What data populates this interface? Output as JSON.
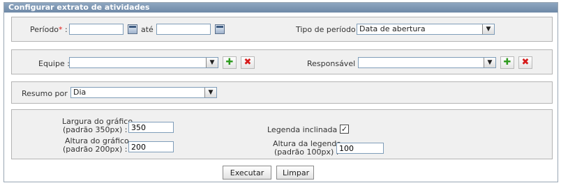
{
  "panel": {
    "title": "Configurar extrato de atividades"
  },
  "periodo": {
    "label": "Período",
    "required_mark": "*",
    "separator": "até",
    "start_value": "",
    "end_value": ""
  },
  "tipo_periodo": {
    "label": "Tipo de período :",
    "selected": "Data de abertura"
  },
  "equipe": {
    "label": "Equipe :",
    "selected": ""
  },
  "responsavel": {
    "label": "Responsável :",
    "selected": ""
  },
  "resumo": {
    "label": "Resumo por :",
    "selected": "Dia"
  },
  "grafico": {
    "largura_label_1": "Largura do gráfico",
    "largura_label_2": "(padrão 350px) :",
    "largura_value": "350",
    "altura_label_1": "Altura do gráfico",
    "altura_label_2": "(padrão 200px) :",
    "altura_value": "200",
    "legenda_inclinada_label": "Legenda inclinada :",
    "legenda_inclinada_checked": true,
    "altura_legenda_label_1": "Altura da legenda",
    "altura_legenda_label_2": "(padrão 100px) :",
    "altura_legenda_value": "100"
  },
  "actions": {
    "execute": "Executar",
    "clear": "Limpar"
  },
  "icons": {
    "check": "✓",
    "dropdown": "▼",
    "add": "✚",
    "remove": "✖"
  }
}
